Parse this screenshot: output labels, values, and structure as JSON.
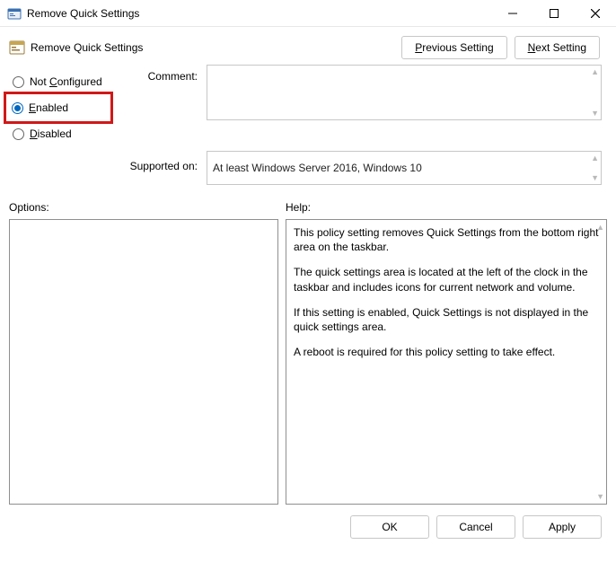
{
  "window": {
    "title": "Remove Quick Settings"
  },
  "header": {
    "policy_title": "Remove Quick Settings"
  },
  "nav": {
    "previous_prefix": "P",
    "previous_rest": "revious Setting",
    "next_prefix": "N",
    "next_rest": "ext Setting"
  },
  "state": {
    "not_configured_prefix": "Not ",
    "not_configured_ul": "C",
    "not_configured_rest": "onfigured",
    "enabled_ul": "E",
    "enabled_rest": "nabled",
    "disabled_ul": "D",
    "disabled_rest": "isabled",
    "selected": "enabled"
  },
  "labels": {
    "comment": "Comment:",
    "supported_on": "Supported on:",
    "options": "Options:",
    "help": "Help:"
  },
  "fields": {
    "comment": "",
    "supported_on": "At least Windows Server 2016, Windows 10"
  },
  "help": {
    "p1": "This policy setting removes Quick Settings from the bottom right area on the taskbar.",
    "p2": "The quick settings area is located at the left of the clock in the taskbar and includes icons for current network and volume.",
    "p3": "If this setting is enabled, Quick Settings is not displayed in the quick settings area.",
    "p4": "A reboot is required for this policy setting to take effect."
  },
  "footer": {
    "ok": "OK",
    "cancel": "Cancel",
    "apply": "Apply"
  }
}
